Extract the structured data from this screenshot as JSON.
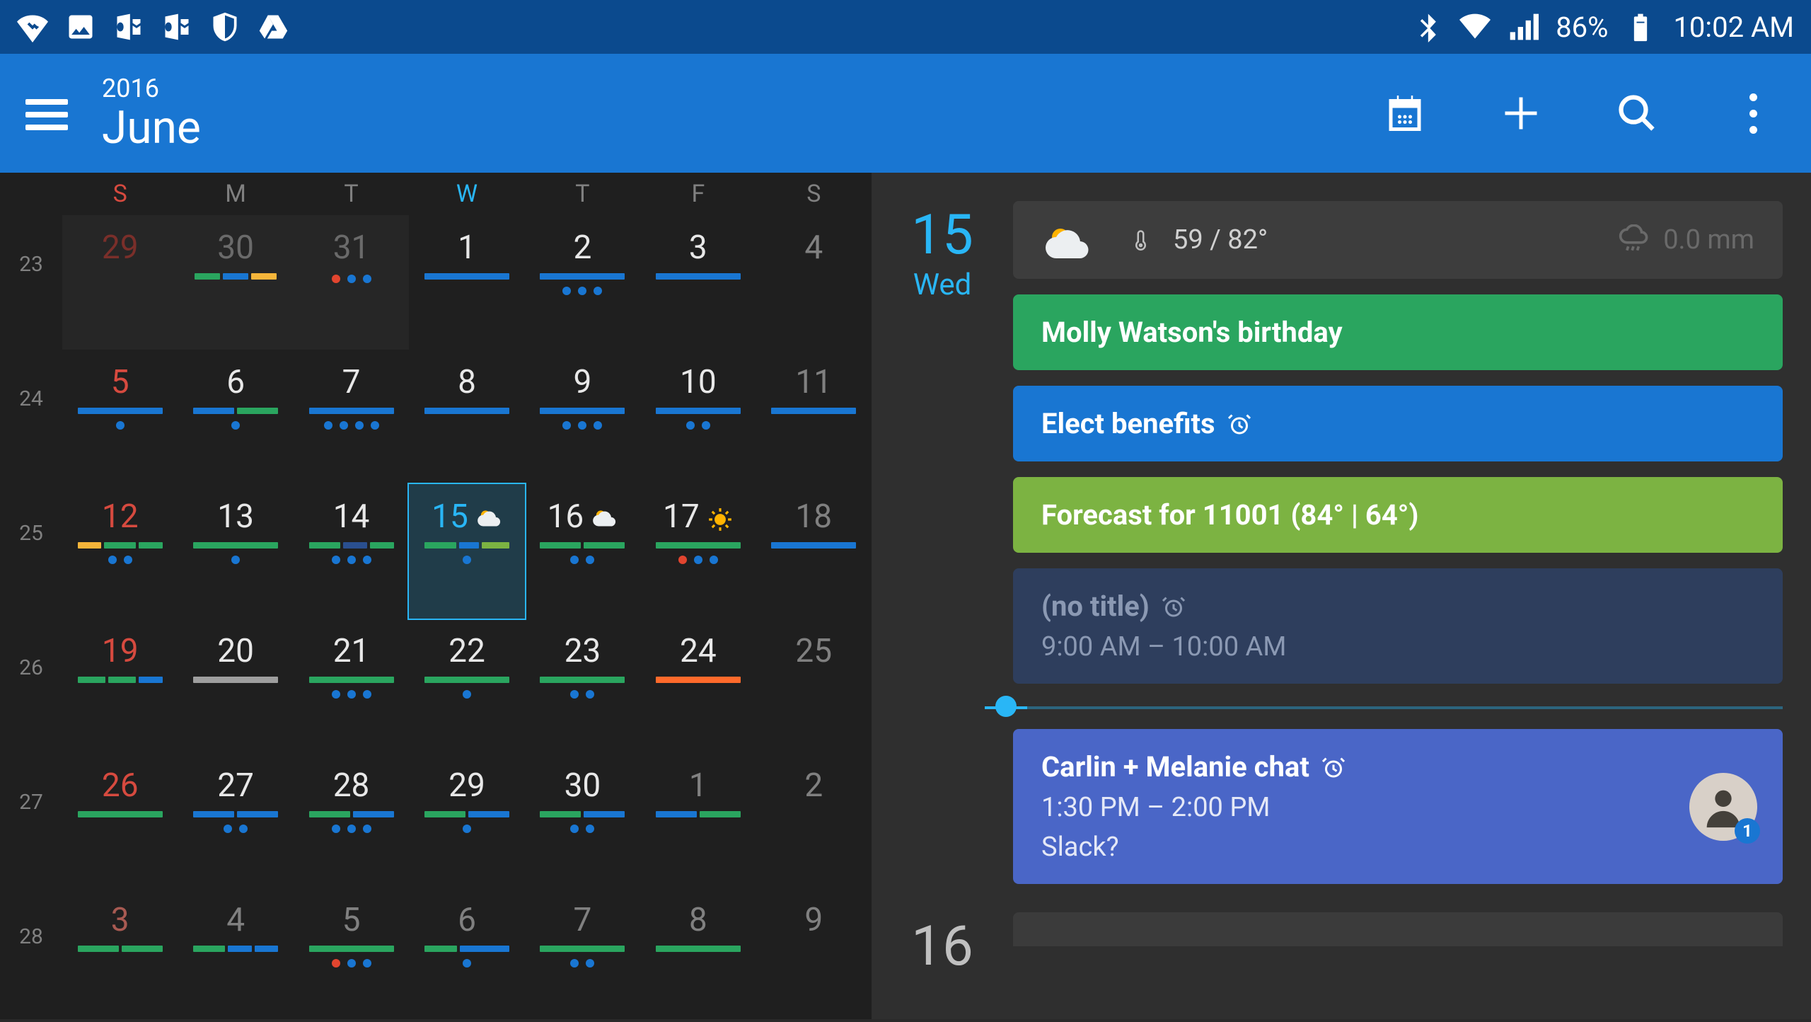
{
  "status": {
    "battery": "86%",
    "time": "10:02 AM"
  },
  "header": {
    "year": "2016",
    "month": "June"
  },
  "calendar": {
    "dow": [
      "S",
      "M",
      "T",
      "W",
      "T",
      "F",
      "S"
    ],
    "today_dow_index": 3,
    "weeks": [
      {
        "num": "23",
        "days": [
          {
            "n": "29",
            "cls": "sun prev",
            "prevBlock": true,
            "bars": [],
            "dots": []
          },
          {
            "n": "30",
            "cls": "prev",
            "prevBlock": true,
            "bars": [
              [
                "c-green",
                30
              ],
              [
                "c-blue",
                30
              ],
              [
                "c-amber",
                30
              ]
            ],
            "dots": []
          },
          {
            "n": "31",
            "cls": "prev",
            "prevBlock": true,
            "bars": [],
            "dots": [
              "c-red",
              "c-blue",
              "c-blue"
            ]
          },
          {
            "n": "1",
            "bars": [
              [
                "c-blue",
                100
              ]
            ],
            "dots": []
          },
          {
            "n": "2",
            "bars": [
              [
                "c-blue",
                100
              ]
            ],
            "dots": [
              "c-blue",
              "c-blue",
              "c-blue"
            ]
          },
          {
            "n": "3",
            "bars": [
              [
                "c-blue",
                100
              ]
            ],
            "dots": []
          },
          {
            "n": "4",
            "cls": "sat",
            "bars": [],
            "dots": []
          }
        ]
      },
      {
        "num": "24",
        "days": [
          {
            "n": "5",
            "cls": "sun",
            "bars": [
              [
                "c-blue",
                100
              ]
            ],
            "dots": [
              "c-blue"
            ]
          },
          {
            "n": "6",
            "bars": [
              [
                "c-blue",
                50
              ],
              [
                "c-green",
                50
              ]
            ],
            "dots": [
              "c-blue"
            ]
          },
          {
            "n": "7",
            "bars": [
              [
                "c-blue",
                100
              ]
            ],
            "dots": [
              "c-blue",
              "c-blue",
              "c-blue",
              "c-blue"
            ]
          },
          {
            "n": "8",
            "bars": [
              [
                "c-blue",
                100
              ]
            ],
            "dots": []
          },
          {
            "n": "9",
            "bars": [
              [
                "c-blue",
                100
              ]
            ],
            "dots": [
              "c-blue",
              "c-blue",
              "c-blue"
            ]
          },
          {
            "n": "10",
            "bars": [
              [
                "c-blue",
                100
              ]
            ],
            "dots": [
              "c-blue",
              "c-blue"
            ]
          },
          {
            "n": "11",
            "cls": "sat",
            "bars": [
              [
                "c-blue",
                100
              ]
            ],
            "dots": []
          }
        ]
      },
      {
        "num": "25",
        "days": [
          {
            "n": "12",
            "cls": "sun",
            "bars": [
              [
                "c-amber",
                30
              ],
              [
                "c-green",
                40
              ],
              [
                "c-green",
                30
              ]
            ],
            "dots": [
              "c-blue",
              "c-blue"
            ]
          },
          {
            "n": "13",
            "bars": [
              [
                "c-green",
                100
              ]
            ],
            "dots": [
              "c-blue"
            ]
          },
          {
            "n": "14",
            "bars": [
              [
                "c-green",
                40
              ],
              [
                "c-dblue",
                30
              ],
              [
                "c-green",
                30
              ]
            ],
            "dots": [
              "c-blue",
              "c-blue",
              "c-blue"
            ]
          },
          {
            "n": "15",
            "selected": true,
            "weather": "partly",
            "bars": [
              [
                "c-green",
                40
              ],
              [
                "c-blue",
                25
              ],
              [
                "c-lime",
                35
              ]
            ],
            "dots": [
              "c-blue"
            ]
          },
          {
            "n": "16",
            "weather": "partly",
            "bars": [
              [
                "c-green",
                50
              ],
              [
                "c-green",
                50
              ]
            ],
            "dots": [
              "c-blue",
              "c-blue"
            ]
          },
          {
            "n": "17",
            "weather": "sunny",
            "bars": [
              [
                "c-green",
                100
              ]
            ],
            "dots": [
              "c-red",
              "c-blue",
              "c-blue"
            ]
          },
          {
            "n": "18",
            "cls": "sat",
            "bars": [
              [
                "c-blue",
                100
              ]
            ],
            "dots": []
          }
        ]
      },
      {
        "num": "26",
        "days": [
          {
            "n": "19",
            "cls": "sun",
            "bars": [
              [
                "c-green",
                35
              ],
              [
                "c-green",
                35
              ],
              [
                "c-blue",
                30
              ]
            ],
            "dots": []
          },
          {
            "n": "20",
            "bars": [
              [
                "c-grey",
                100
              ]
            ],
            "dots": []
          },
          {
            "n": "21",
            "bars": [
              [
                "c-green",
                100
              ]
            ],
            "dots": [
              "c-blue",
              "c-blue",
              "c-blue"
            ]
          },
          {
            "n": "22",
            "bars": [
              [
                "c-green",
                100
              ]
            ],
            "dots": [
              "c-blue"
            ]
          },
          {
            "n": "23",
            "bars": [
              [
                "c-green",
                100
              ]
            ],
            "dots": [
              "c-blue",
              "c-blue"
            ]
          },
          {
            "n": "24",
            "bars": [
              [
                "c-orange",
                100
              ]
            ],
            "dots": []
          },
          {
            "n": "25",
            "cls": "sat",
            "bars": [],
            "dots": []
          }
        ]
      },
      {
        "num": "27",
        "days": [
          {
            "n": "26",
            "cls": "sun",
            "bars": [
              [
                "c-green",
                100
              ]
            ],
            "dots": []
          },
          {
            "n": "27",
            "bars": [
              [
                "c-blue",
                50
              ],
              [
                "c-blue",
                50
              ]
            ],
            "dots": [
              "c-blue",
              "c-blue"
            ]
          },
          {
            "n": "28",
            "bars": [
              [
                "c-green",
                50
              ],
              [
                "c-blue",
                50
              ]
            ],
            "dots": [
              "c-blue",
              "c-blue",
              "c-blue"
            ]
          },
          {
            "n": "29",
            "bars": [
              [
                "c-green",
                50
              ],
              [
                "c-blue",
                50
              ]
            ],
            "dots": [
              "c-blue"
            ]
          },
          {
            "n": "30",
            "bars": [
              [
                "c-green",
                50
              ],
              [
                "c-blue",
                50
              ]
            ],
            "dots": [
              "c-blue",
              "c-blue"
            ]
          },
          {
            "n": "1",
            "cls": "next",
            "bars": [
              [
                "c-blue",
                50
              ],
              [
                "c-green",
                50
              ]
            ],
            "dots": []
          },
          {
            "n": "2",
            "cls": "sat next",
            "bars": [],
            "dots": []
          }
        ]
      },
      {
        "num": "28",
        "days": [
          {
            "n": "3",
            "cls": "sun next",
            "bars": [
              [
                "c-green",
                50
              ],
              [
                "c-green",
                50
              ]
            ],
            "dots": []
          },
          {
            "n": "4",
            "cls": "next",
            "bars": [
              [
                "c-green",
                40
              ],
              [
                "c-blue",
                30
              ],
              [
                "c-blue",
                30
              ]
            ],
            "dots": []
          },
          {
            "n": "5",
            "cls": "next",
            "bars": [
              [
                "c-green",
                100
              ]
            ],
            "dots": [
              "c-red",
              "c-blue",
              "c-blue"
            ]
          },
          {
            "n": "6",
            "cls": "next",
            "bars": [
              [
                "c-green",
                40
              ],
              [
                "c-blue",
                60
              ]
            ],
            "dots": [
              "c-blue"
            ]
          },
          {
            "n": "7",
            "cls": "next",
            "bars": [
              [
                "c-green",
                100
              ]
            ],
            "dots": [
              "c-blue",
              "c-blue"
            ]
          },
          {
            "n": "8",
            "cls": "next",
            "bars": [
              [
                "c-green",
                100
              ]
            ],
            "dots": []
          },
          {
            "n": "9",
            "cls": "sat next",
            "bars": [],
            "dots": []
          }
        ]
      }
    ]
  },
  "agenda": {
    "day_num": "15",
    "day_name": "Wed",
    "weather": {
      "temp": "59 / 82°",
      "precip": "0.0 mm"
    },
    "events": [
      {
        "title": "Molly Watson's birthday",
        "color": "c-green",
        "alarm": false
      },
      {
        "title": "Elect benefits",
        "color": "c-blue",
        "alarm": true
      },
      {
        "title": "Forecast for 11001 (84° | 64°)",
        "color": "c-lime",
        "alarm": false
      },
      {
        "title": "(no title)",
        "sub": "9:00 AM – 10:00 AM",
        "color": "c-navy",
        "alarm": true,
        "dim": true
      },
      {
        "title": "Carlin + Melanie chat",
        "sub": "1:30 PM – 2:00 PM",
        "body": "Slack?",
        "color": "c-indigo",
        "alarm": true,
        "avatar": true,
        "avatar_badge": "1"
      }
    ],
    "next_day_num": "16"
  }
}
